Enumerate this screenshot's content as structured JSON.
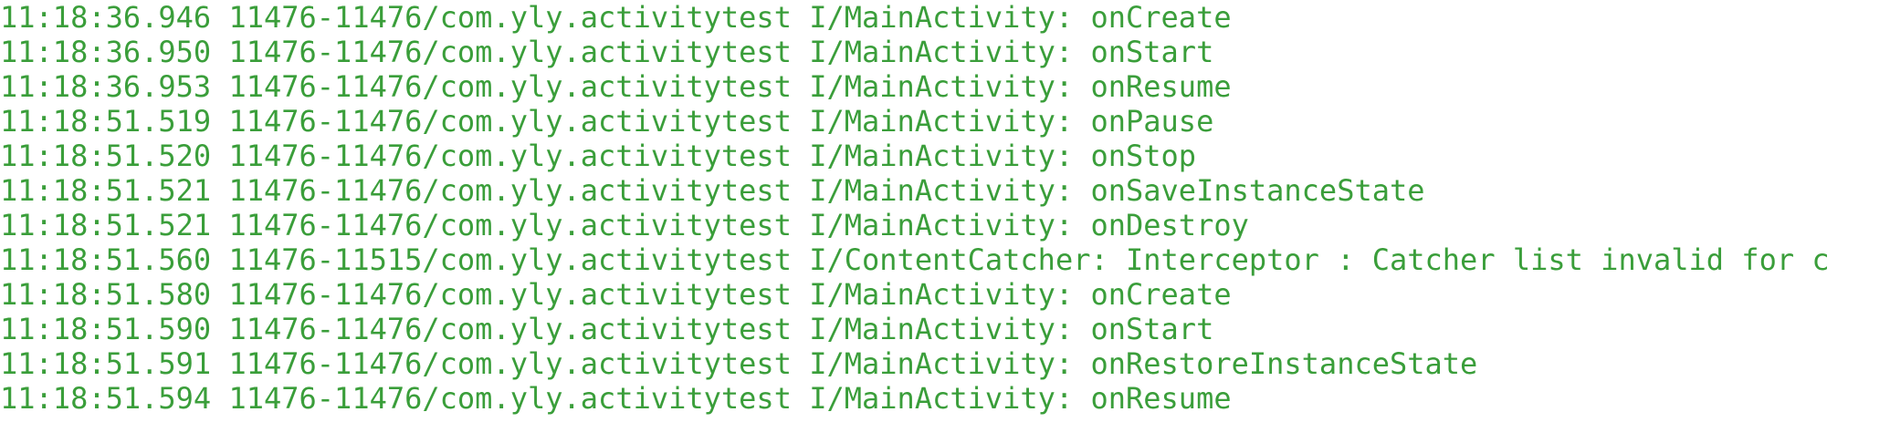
{
  "log": {
    "color": "#3a9e3a",
    "lines": [
      "11:18:36.946 11476-11476/com.yly.activitytest I/MainActivity: onCreate",
      "11:18:36.950 11476-11476/com.yly.activitytest I/MainActivity: onStart",
      "11:18:36.953 11476-11476/com.yly.activitytest I/MainActivity: onResume",
      "11:18:51.519 11476-11476/com.yly.activitytest I/MainActivity: onPause",
      "11:18:51.520 11476-11476/com.yly.activitytest I/MainActivity: onStop",
      "11:18:51.521 11476-11476/com.yly.activitytest I/MainActivity: onSaveInstanceState",
      "11:18:51.521 11476-11476/com.yly.activitytest I/MainActivity: onDestroy",
      "11:18:51.560 11476-11515/com.yly.activitytest I/ContentCatcher: Interceptor : Catcher list invalid for c",
      "11:18:51.580 11476-11476/com.yly.activitytest I/MainActivity: onCreate",
      "11:18:51.590 11476-11476/com.yly.activitytest I/MainActivity: onStart",
      "11:18:51.591 11476-11476/com.yly.activitytest I/MainActivity: onRestoreInstanceState",
      "11:18:51.594 11476-11476/com.yly.activitytest I/MainActivity: onResume"
    ]
  }
}
